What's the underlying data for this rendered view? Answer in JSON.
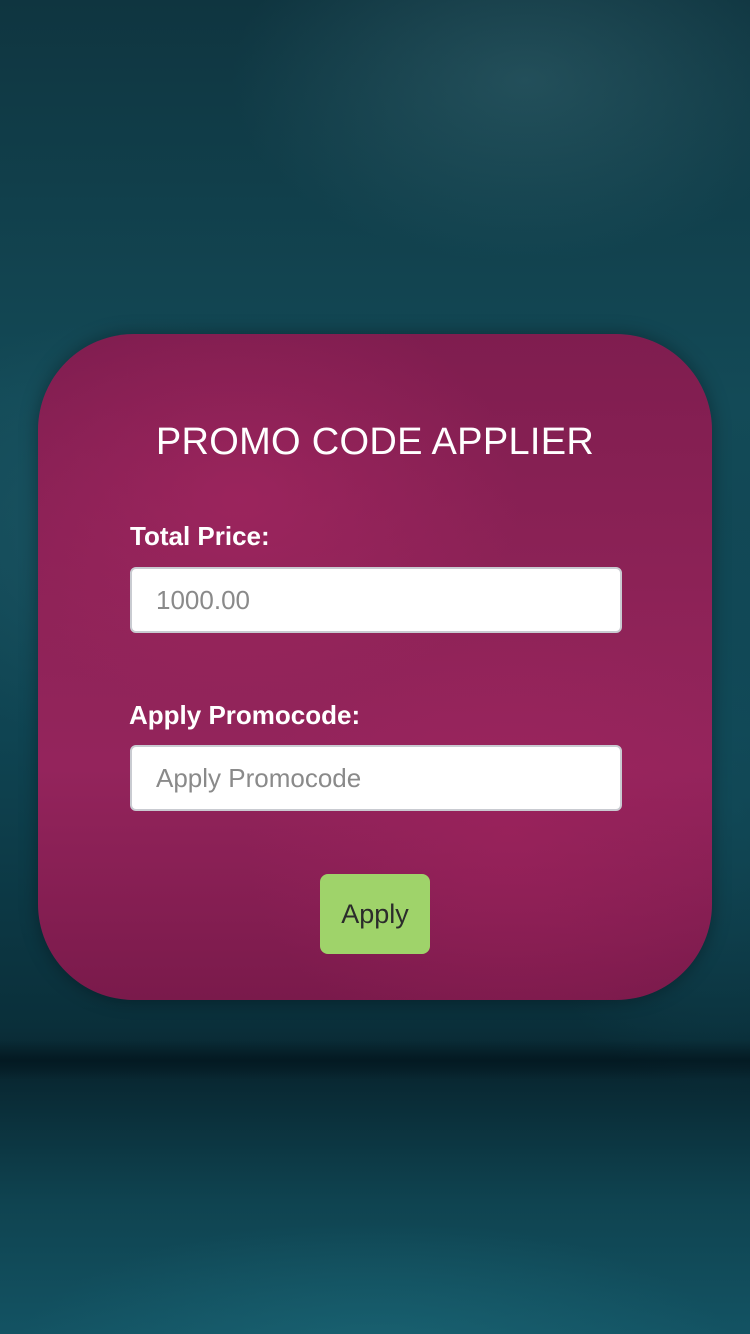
{
  "card": {
    "title": "PROMO CODE APPLIER"
  },
  "total_price": {
    "label": "Total Price:",
    "placeholder": "1000.00",
    "value": ""
  },
  "promocode": {
    "label": "Apply Promocode:",
    "placeholder": "Apply Promocode",
    "value": ""
  },
  "apply_button": {
    "label": "Apply"
  },
  "colors": {
    "background": "#134a57",
    "card": "#8f2358",
    "button": "#9fd36a",
    "text": "#ffffff"
  }
}
